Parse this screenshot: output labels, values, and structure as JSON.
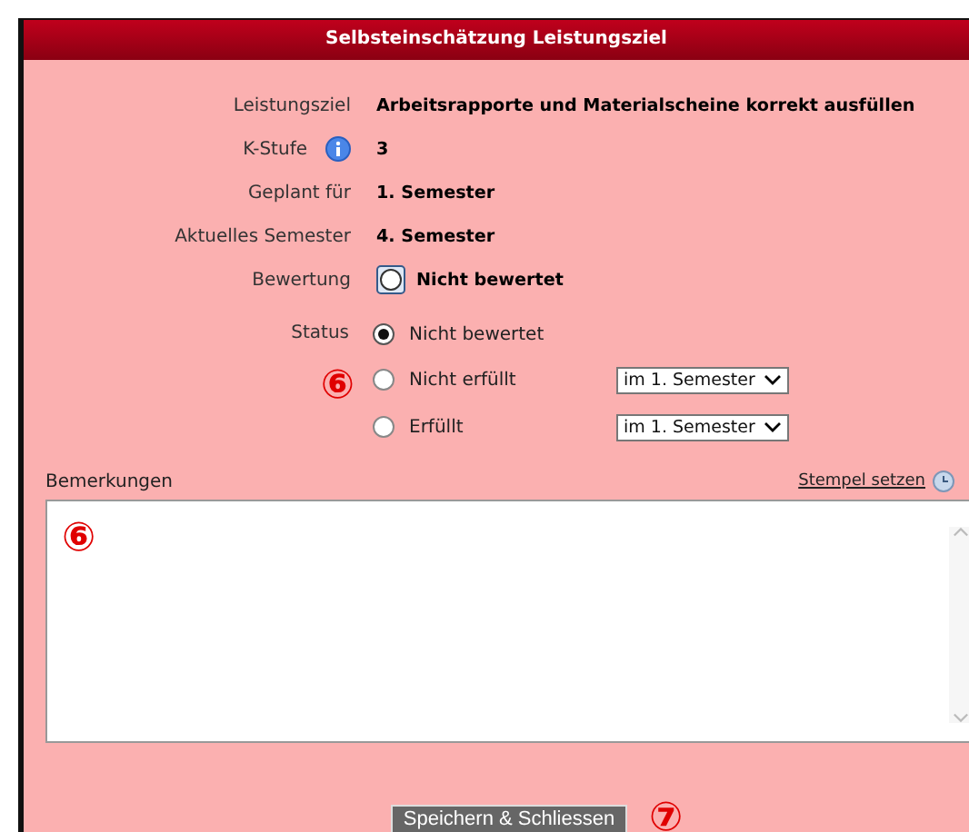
{
  "dialog": {
    "title": "Selbsteinschätzung Leistungsziel",
    "fields": [
      {
        "label": "Leistungsziel",
        "value": "Arbeitsrapporte und Materialscheine korrekt ausfüllen",
        "info": false
      },
      {
        "label": "K-Stufe",
        "value": "3",
        "info": true
      },
      {
        "label": "Geplant für",
        "value": "1. Semester",
        "info": false
      },
      {
        "label": "Aktuelles Semester",
        "value": "4. Semester",
        "info": false
      }
    ],
    "rating": {
      "label": "Bewertung",
      "value": "Nicht bewertet"
    },
    "status": {
      "label": "Status",
      "marker": "⑥",
      "options": [
        {
          "label": "Nicht bewertet",
          "selected": true
        },
        {
          "label": "Nicht erfüllt",
          "selected": false,
          "semester": "im 1. Semester"
        },
        {
          "label": "Erfüllt",
          "selected": false,
          "semester": "im 1. Semester"
        }
      ]
    },
    "remarks": {
      "label": "Bemerkungen",
      "stamp_link": "Stempel setzen",
      "marker": "⑥"
    },
    "save_button": {
      "label": "Speichern & Schliessen",
      "marker": "⑦"
    }
  }
}
